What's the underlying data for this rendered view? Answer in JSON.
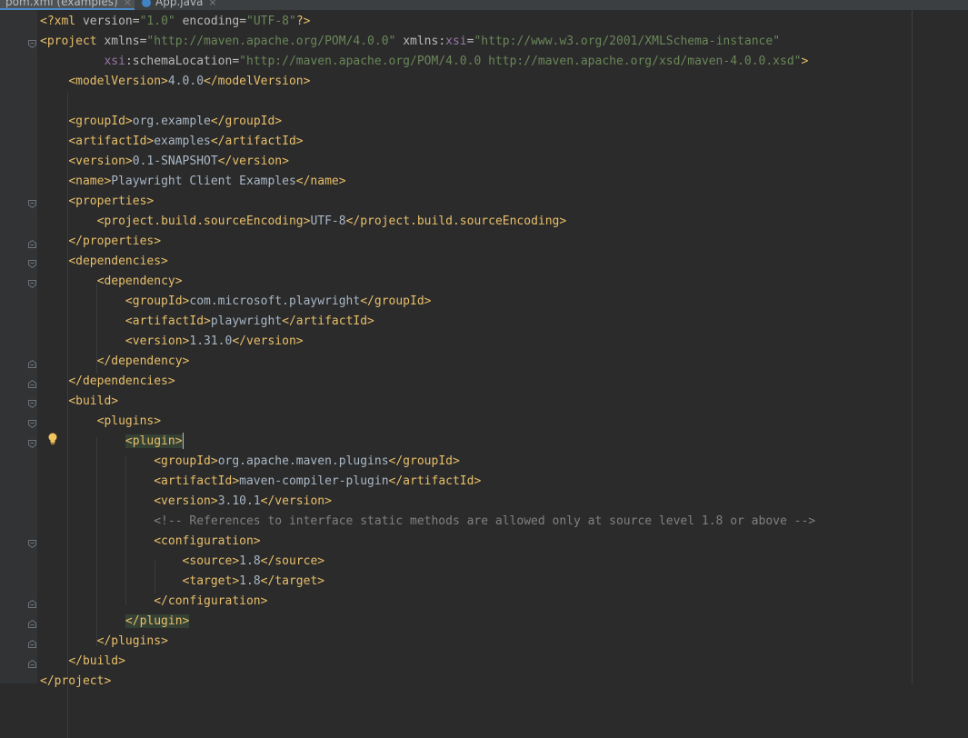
{
  "tabs": [
    {
      "label": "pom.xml (examples)",
      "active": true,
      "close": "×"
    },
    {
      "label": "App.java",
      "active": false,
      "close": "×"
    }
  ],
  "code": {
    "decl": {
      "open": "<?xml ",
      "version_attr": "version",
      "eq": "=",
      "version_val": "\"1.0\"",
      "enc_attr": "encoding",
      "enc_val": "\"UTF-8\"",
      "close": "?>"
    },
    "project_open": {
      "tag": "<project ",
      "xmlns_attr": "xmlns",
      "eq": "=",
      "xmlns_val": "\"http://maven.apache.org/POM/4.0.0\"",
      "xsi_prefix": "xmlns:",
      "xsi_ns": "xsi",
      "xsi_val": "\"http://www.w3.org/2001/XMLSchema-instance\""
    },
    "schema_line": {
      "ns": "xsi",
      "attr": ":schemaLocation",
      "eq": "=",
      "val": "\"http://maven.apache.org/POM/4.0.0 http://maven.apache.org/xsd/maven-4.0.0.xsd\"",
      "close": ">"
    },
    "modelVersion": {
      "open": "<modelVersion>",
      "value": "4.0.0",
      "close": "</modelVersion>"
    },
    "groupId": {
      "open": "<groupId>",
      "value": "org.example",
      "close": "</groupId>"
    },
    "artifactId": {
      "open": "<artifactId>",
      "value": "examples",
      "close": "</artifactId>"
    },
    "version": {
      "open": "<version>",
      "value": "0.1-SNAPSHOT",
      "close": "</version>"
    },
    "name": {
      "open": "<name>",
      "value": "Playwright Client Examples",
      "close": "</name>"
    },
    "properties_open": "<properties>",
    "encoding": {
      "open": "<project.build.sourceEncoding>",
      "value": "UTF-8",
      "close": "</project.build.sourceEncoding>"
    },
    "properties_close": "</properties>",
    "dependencies_open": "<dependencies>",
    "dependency_open": "<dependency>",
    "dep_groupId": {
      "open": "<groupId>",
      "value": "com.microsoft.playwright",
      "close": "</groupId>"
    },
    "dep_artifactId": {
      "open": "<artifactId>",
      "value": "playwright",
      "close": "</artifactId>"
    },
    "dep_version": {
      "open": "<version>",
      "value": "1.31.0",
      "close": "</version>"
    },
    "dependency_close": "</dependency>",
    "dependencies_close": "</dependencies>",
    "build_open": "<build>",
    "plugins_open": "<plugins>",
    "plugin_open": "<plugin>",
    "plg_groupId": {
      "open": "<groupId>",
      "value": "org.apache.maven.plugins",
      "close": "</groupId>"
    },
    "plg_artifactId": {
      "open": "<artifactId>",
      "value": "maven-compiler-plugin",
      "close": "</artifactId>"
    },
    "plg_version": {
      "open": "<version>",
      "value": "3.10.1",
      "close": "</version>"
    },
    "comment": "<!-- References to interface static methods are allowed only at source level 1.8 or above -->",
    "configuration_open": "<configuration>",
    "source": {
      "open": "<source>",
      "value": "1.8",
      "close": "</source>"
    },
    "target": {
      "open": "<target>",
      "value": "1.8",
      "close": "</target>"
    },
    "configuration_close": "</configuration>",
    "plugin_close": "</plugin>",
    "plugins_close": "</plugins>",
    "build_close": "</build>",
    "project_close": "</project>"
  },
  "icons": {
    "fold": "fold-marker-icon",
    "intention": "lightbulb-icon",
    "file": "java-file-icon"
  },
  "colors": {
    "tag": "#e8bf6a",
    "attr": "#bababa",
    "string": "#6a8759",
    "namespace": "#9876aa",
    "comment": "#808080",
    "text": "#a9b7c6",
    "background": "#2b2b2b",
    "tag_match": "#344134"
  }
}
